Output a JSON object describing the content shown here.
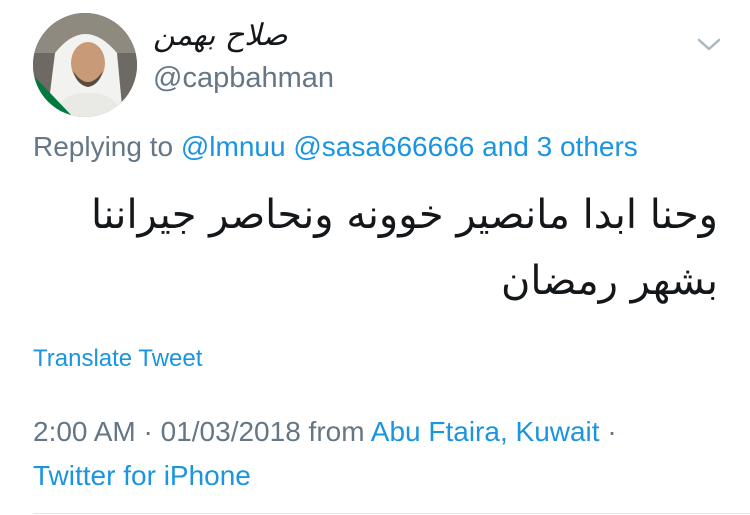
{
  "author": {
    "display_name": "صلاح بهمن",
    "handle": "@capbahman"
  },
  "reply": {
    "prefix": "Replying to",
    "mentions": [
      "@lmnuu",
      "@sasa666666"
    ],
    "others": "and 3 others"
  },
  "tweet": {
    "text_line1": "وحنا ابدا مانصير خوونه ونحاصر جيراننا",
    "text_line2": "بشهر رمضان"
  },
  "translate_label": "Translate Tweet",
  "meta": {
    "time": "2:00 AM",
    "date": "01/03/2018",
    "from_label": "from",
    "location": "Abu Ftaira, Kuwait",
    "source": "Twitter for iPhone"
  },
  "colors": {
    "link": "#1b95e0",
    "muted": "#657786",
    "text": "#14171a"
  },
  "icons": {
    "menu": "chevron-down-icon"
  }
}
